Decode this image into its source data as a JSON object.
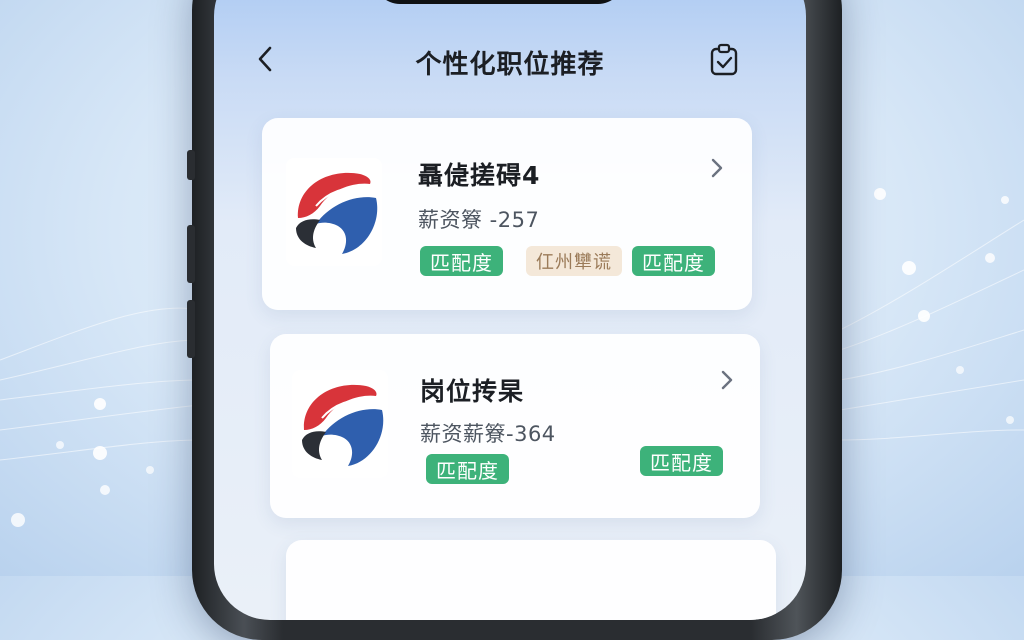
{
  "nav": {
    "title": "个性化职位推荐"
  },
  "jobs": [
    {
      "title": "聶偼搓碍4",
      "salary": "薪资簝 -257",
      "tags": [
        "匹配度",
        "仜州犫谎",
        "匹配度"
      ]
    },
    {
      "title": "岗位抟杲",
      "salary": "薪资薪簝-364",
      "tags": [
        "匹配度",
        "匹配度"
      ]
    }
  ],
  "colors": {
    "tag_green": "#3db27a",
    "tag_beige": "#f4e8d9",
    "logo_red": "#d8343a",
    "logo_blue": "#2f5fae",
    "logo_dark": "#2b2f36"
  },
  "icons": {
    "back": "chevron-left-icon",
    "action": "clipboard-check-icon",
    "card_arrow": "chevron-right-icon"
  }
}
